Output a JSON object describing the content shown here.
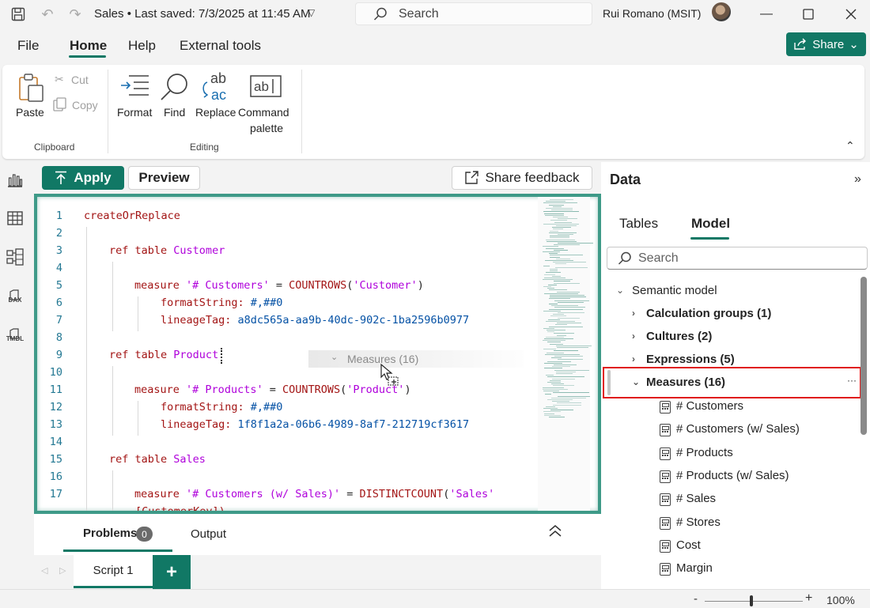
{
  "titlebar": {
    "title": "Sales • Last saved: 7/3/2025 at 11:45 AM",
    "search_placeholder": "Search",
    "user": "Rui Romano (MSIT)"
  },
  "menu": {
    "items": [
      "File",
      "Home",
      "Help",
      "External tools"
    ],
    "share_label": "Share"
  },
  "ribbon": {
    "clipboard": {
      "paste": "Paste",
      "cut": "Cut",
      "copy": "Copy",
      "group": "Clipboard"
    },
    "editing": {
      "format": "Format",
      "find": "Find",
      "replace": "Replace",
      "command_line1": "Command",
      "command_line2": "palette",
      "group": "Editing"
    }
  },
  "rail": {
    "dax": "DAX",
    "tmdl": "TMDL"
  },
  "toolbar": {
    "apply": "Apply",
    "preview": "Preview",
    "feedback": "Share feedback"
  },
  "editor": {
    "lines": [
      {
        "n": "1",
        "code": "createOrReplace"
      },
      {
        "n": "2",
        "code": ""
      },
      {
        "n": "3",
        "code": "ref table Customer"
      },
      {
        "n": "4",
        "code": ""
      },
      {
        "n": "5",
        "code": "measure '# Customers' = COUNTROWS('Customer')"
      },
      {
        "n": "6",
        "code": "formatString: #,##0"
      },
      {
        "n": "7",
        "code": "lineageTag: a8dc565a-aa9b-40dc-902c-1ba2596b0977"
      },
      {
        "n": "8",
        "code": ""
      },
      {
        "n": "9",
        "code": "ref table Product"
      },
      {
        "n": "10",
        "code": ""
      },
      {
        "n": "11",
        "code": "measure '# Products' = COUNTROWS('Product')"
      },
      {
        "n": "12",
        "code": "formatString: #,##0"
      },
      {
        "n": "13",
        "code": "lineageTag: 1f8f1a2a-06b6-4989-8af7-212719cf3617"
      },
      {
        "n": "14",
        "code": ""
      },
      {
        "n": "15",
        "code": "ref table Sales"
      },
      {
        "n": "16",
        "code": ""
      },
      {
        "n": "17",
        "code": "measure '# Customers (w/ Sales)' = DISTINCTCOUNT('Sales'"
      }
    ],
    "wrap_line": "[CustomerKey])",
    "drag_ghost": "Measures (16)"
  },
  "bottom": {
    "problems": "Problems",
    "problems_count": "0",
    "output": "Output",
    "script_tab": "Script 1"
  },
  "data_pane": {
    "title": "Data",
    "tabs": [
      "Tables",
      "Model"
    ],
    "search_placeholder": "Search",
    "tree": {
      "root": "Semantic model",
      "groups": [
        "Calculation groups (1)",
        "Cultures (2)",
        "Expressions (5)",
        "Measures (16)"
      ],
      "measures": [
        "# Customers",
        "# Customers (w/ Sales)",
        "# Products",
        "# Products (w/ Sales)",
        "# Sales",
        "# Stores",
        "Cost",
        "Margin"
      ]
    },
    "more": "···"
  },
  "status": {
    "zoom": "100%"
  },
  "colors": {
    "accent": "#117865",
    "highlight": "#e01b1b"
  }
}
